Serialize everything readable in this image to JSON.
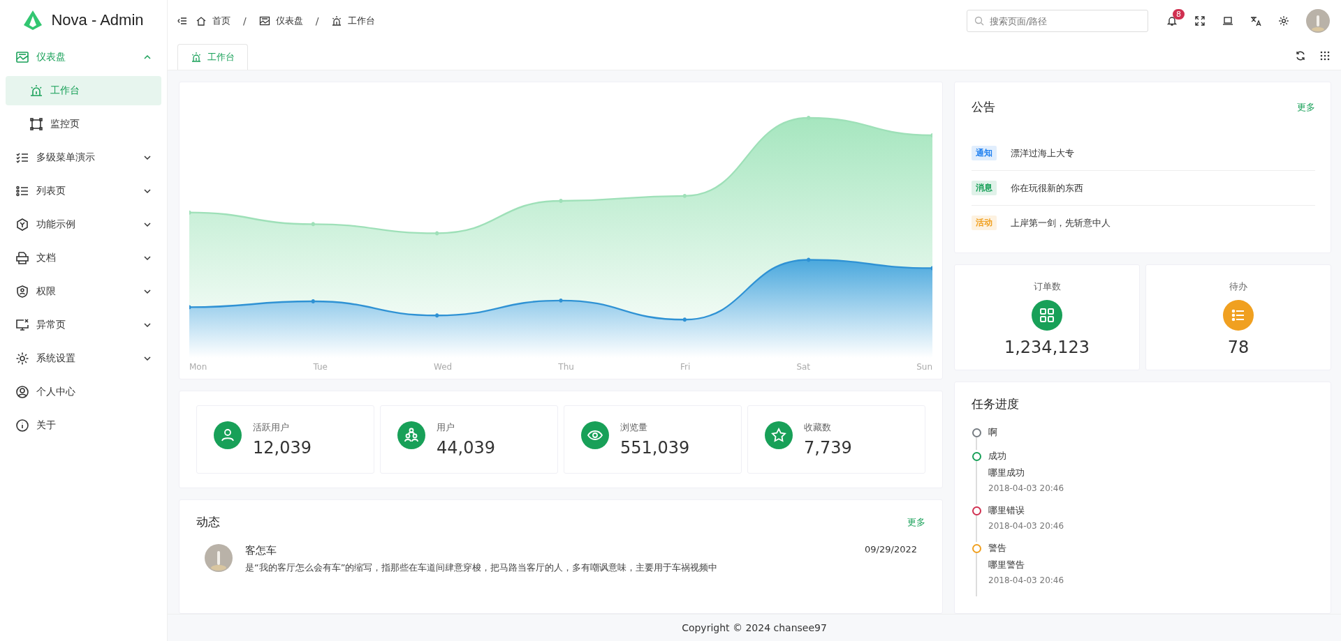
{
  "sidebar": {
    "logo_text": "Nova - Admin",
    "items": [
      {
        "label": "仪表盘",
        "expanded": true,
        "selected": false,
        "children": [
          {
            "label": "工作台",
            "selected": true
          },
          {
            "label": "监控页",
            "selected": false
          }
        ]
      },
      {
        "label": "多级菜单演示",
        "expanded": false,
        "selected": false
      },
      {
        "label": "列表页",
        "expanded": false,
        "selected": false
      },
      {
        "label": "功能示例",
        "expanded": false,
        "selected": false
      },
      {
        "label": "文档",
        "expanded": false,
        "selected": false
      },
      {
        "label": "权限",
        "expanded": false,
        "selected": false
      },
      {
        "label": "异常页",
        "expanded": false,
        "selected": false
      },
      {
        "label": "系统设置",
        "expanded": false,
        "selected": false
      },
      {
        "label": "个人中心",
        "selected": false
      },
      {
        "label": "关于",
        "selected": false
      }
    ]
  },
  "header": {
    "separator": "/",
    "breadcrumb": [
      {
        "label": "首页"
      },
      {
        "label": "仪表盘"
      },
      {
        "label": "工作台"
      }
    ],
    "search": {
      "placeholder": "搜索页面/路径"
    },
    "notification_count": "8"
  },
  "tabs": [
    {
      "label": "工作台",
      "selected": true
    }
  ],
  "chart": {
    "x_labels": [
      "Mon",
      "Tue",
      "Wed",
      "Thu",
      "Fri",
      "Sat",
      "Sun"
    ]
  },
  "stats": [
    {
      "label": "活跃用户",
      "value": "12,039"
    },
    {
      "label": "用户",
      "value": "44,039"
    },
    {
      "label": "浏览量",
      "value": "551,039"
    },
    {
      "label": "收藏数",
      "value": "7,739"
    }
  ],
  "activity": {
    "title": "动态",
    "more": "更多",
    "items": [
      {
        "name": "客怎车",
        "date": "09/29/2022",
        "text": "是“我的客厅怎么会有车”的缩写，指那些在车道间肆意穿梭，把马路当客厅的人，多有嘲讽意味，主要用于车祸视频中"
      }
    ]
  },
  "notices": {
    "title": "公告",
    "more": "更多",
    "items": [
      {
        "tag": "通知",
        "text": "漂洋过海上大专",
        "color": "#2080f0"
      },
      {
        "tag": "消息",
        "text": "你在玩很新的东西",
        "color": "#18a058"
      },
      {
        "tag": "活动",
        "text": "上岸第一剑，先斩意中人",
        "color": "#f0a020"
      }
    ]
  },
  "counters": [
    {
      "label": "订单数",
      "value": "1,234,123",
      "color": "#18a058"
    },
    {
      "label": "待办",
      "value": "78",
      "color": "#f0a020"
    }
  ],
  "tasks": {
    "title": "任务进度",
    "items": [
      {
        "title": "啊",
        "color": "#767c82"
      },
      {
        "title": "成功",
        "description": "哪里成功",
        "time": "2018-04-03 20:46",
        "color": "#18a058"
      },
      {
        "title": "哪里错误",
        "time": "2018-04-03 20:46",
        "color": "#d03050"
      },
      {
        "title": "警告",
        "description": "哪里警告",
        "time": "2018-04-03 20:46",
        "color": "#f0a020"
      }
    ]
  },
  "footer": {
    "text": "Copyright © 2024 chansee97"
  }
}
